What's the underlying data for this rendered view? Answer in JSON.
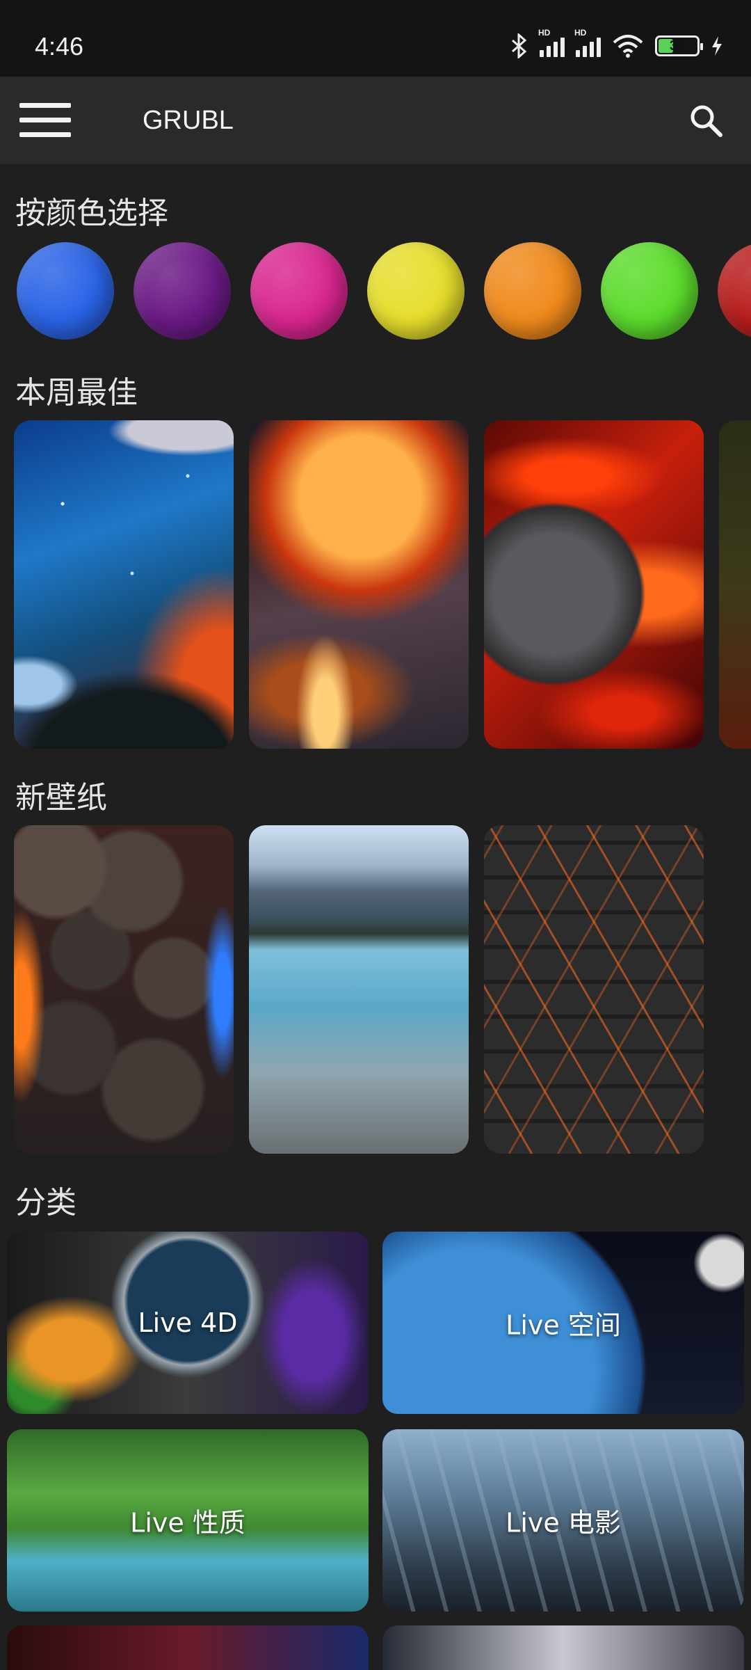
{
  "status_bar": {
    "time": "4:46",
    "battery": "38",
    "signal_label": "HD"
  },
  "app_bar": {
    "title": "GRUBL"
  },
  "sections": {
    "colors": "按颜色选择",
    "best_week": "本周最佳",
    "new_wallpapers": "新壁纸",
    "categories": "分类"
  },
  "color_swatches": [
    {
      "name": "blue",
      "color": "#2a63e6"
    },
    {
      "name": "purple",
      "color": "#6b1a86"
    },
    {
      "name": "magenta",
      "color": "#d92690"
    },
    {
      "name": "yellow",
      "color": "#e6de2c"
    },
    {
      "name": "orange",
      "color": "#f08a1c"
    },
    {
      "name": "green",
      "color": "#5cdc2c"
    },
    {
      "name": "red",
      "color": "#b81c1c"
    }
  ],
  "categories": [
    {
      "label": "Live 4D"
    },
    {
      "label": "Live 空间"
    },
    {
      "label": "Live 性质"
    },
    {
      "label": "Live 电影"
    }
  ]
}
